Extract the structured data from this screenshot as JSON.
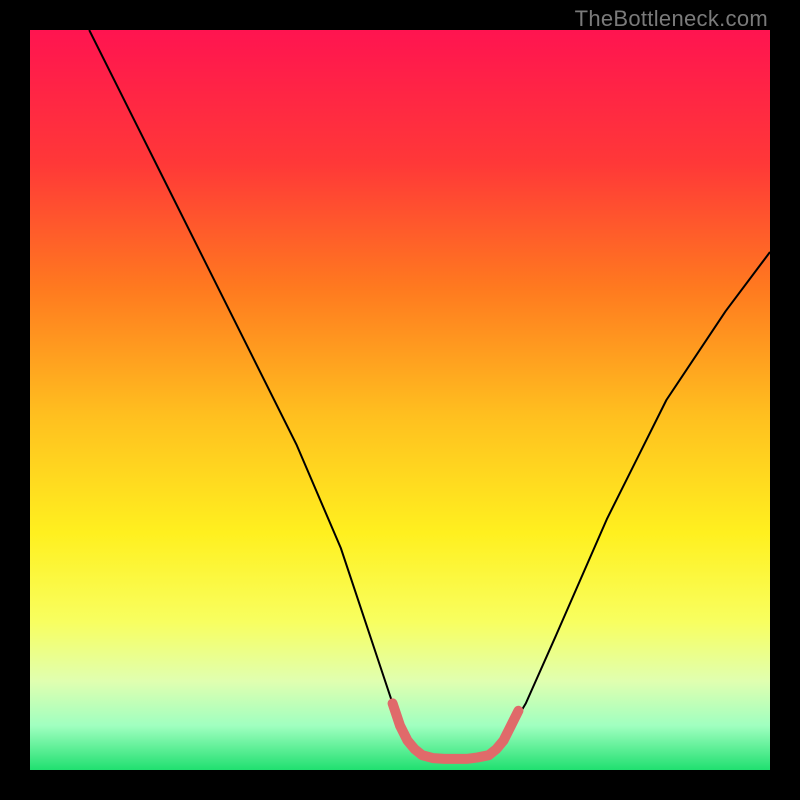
{
  "watermark": "TheBottleneck.com",
  "chart_data": {
    "type": "line",
    "title": "",
    "xlabel": "",
    "ylabel": "",
    "xlim": [
      0,
      100
    ],
    "ylim": [
      0,
      100
    ],
    "gradient_stops": [
      {
        "offset": 0,
        "color": "#ff1450"
      },
      {
        "offset": 18,
        "color": "#ff3838"
      },
      {
        "offset": 35,
        "color": "#ff7a1f"
      },
      {
        "offset": 52,
        "color": "#ffbf1f"
      },
      {
        "offset": 68,
        "color": "#fff01f"
      },
      {
        "offset": 80,
        "color": "#f8ff60"
      },
      {
        "offset": 88,
        "color": "#e0ffb0"
      },
      {
        "offset": 94,
        "color": "#a0ffc0"
      },
      {
        "offset": 100,
        "color": "#20e070"
      }
    ],
    "series": [
      {
        "name": "bottleneck-curve",
        "stroke": "#000000",
        "width": 2,
        "points": [
          {
            "x": 8,
            "y": 100
          },
          {
            "x": 12,
            "y": 92
          },
          {
            "x": 18,
            "y": 80
          },
          {
            "x": 24,
            "y": 68
          },
          {
            "x": 30,
            "y": 56
          },
          {
            "x": 36,
            "y": 44
          },
          {
            "x": 42,
            "y": 30
          },
          {
            "x": 46,
            "y": 18
          },
          {
            "x": 49,
            "y": 9
          },
          {
            "x": 51,
            "y": 4
          },
          {
            "x": 53,
            "y": 2
          },
          {
            "x": 56,
            "y": 1.5
          },
          {
            "x": 59,
            "y": 1.5
          },
          {
            "x": 62,
            "y": 2
          },
          {
            "x": 64,
            "y": 4
          },
          {
            "x": 67,
            "y": 9
          },
          {
            "x": 71,
            "y": 18
          },
          {
            "x": 78,
            "y": 34
          },
          {
            "x": 86,
            "y": 50
          },
          {
            "x": 94,
            "y": 62
          },
          {
            "x": 100,
            "y": 70
          }
        ]
      },
      {
        "name": "optimal-band",
        "stroke": "#e06a6a",
        "width": 10,
        "points": [
          {
            "x": 49,
            "y": 9
          },
          {
            "x": 50,
            "y": 6
          },
          {
            "x": 51,
            "y": 4
          },
          {
            "x": 52,
            "y": 2.8
          },
          {
            "x": 53,
            "y": 2
          },
          {
            "x": 54.5,
            "y": 1.6
          },
          {
            "x": 56,
            "y": 1.5
          },
          {
            "x": 57.5,
            "y": 1.5
          },
          {
            "x": 59,
            "y": 1.5
          },
          {
            "x": 60.5,
            "y": 1.7
          },
          {
            "x": 62,
            "y": 2
          },
          {
            "x": 63,
            "y": 2.8
          },
          {
            "x": 64,
            "y": 4
          },
          {
            "x": 65,
            "y": 6
          },
          {
            "x": 66,
            "y": 8
          }
        ]
      }
    ]
  }
}
